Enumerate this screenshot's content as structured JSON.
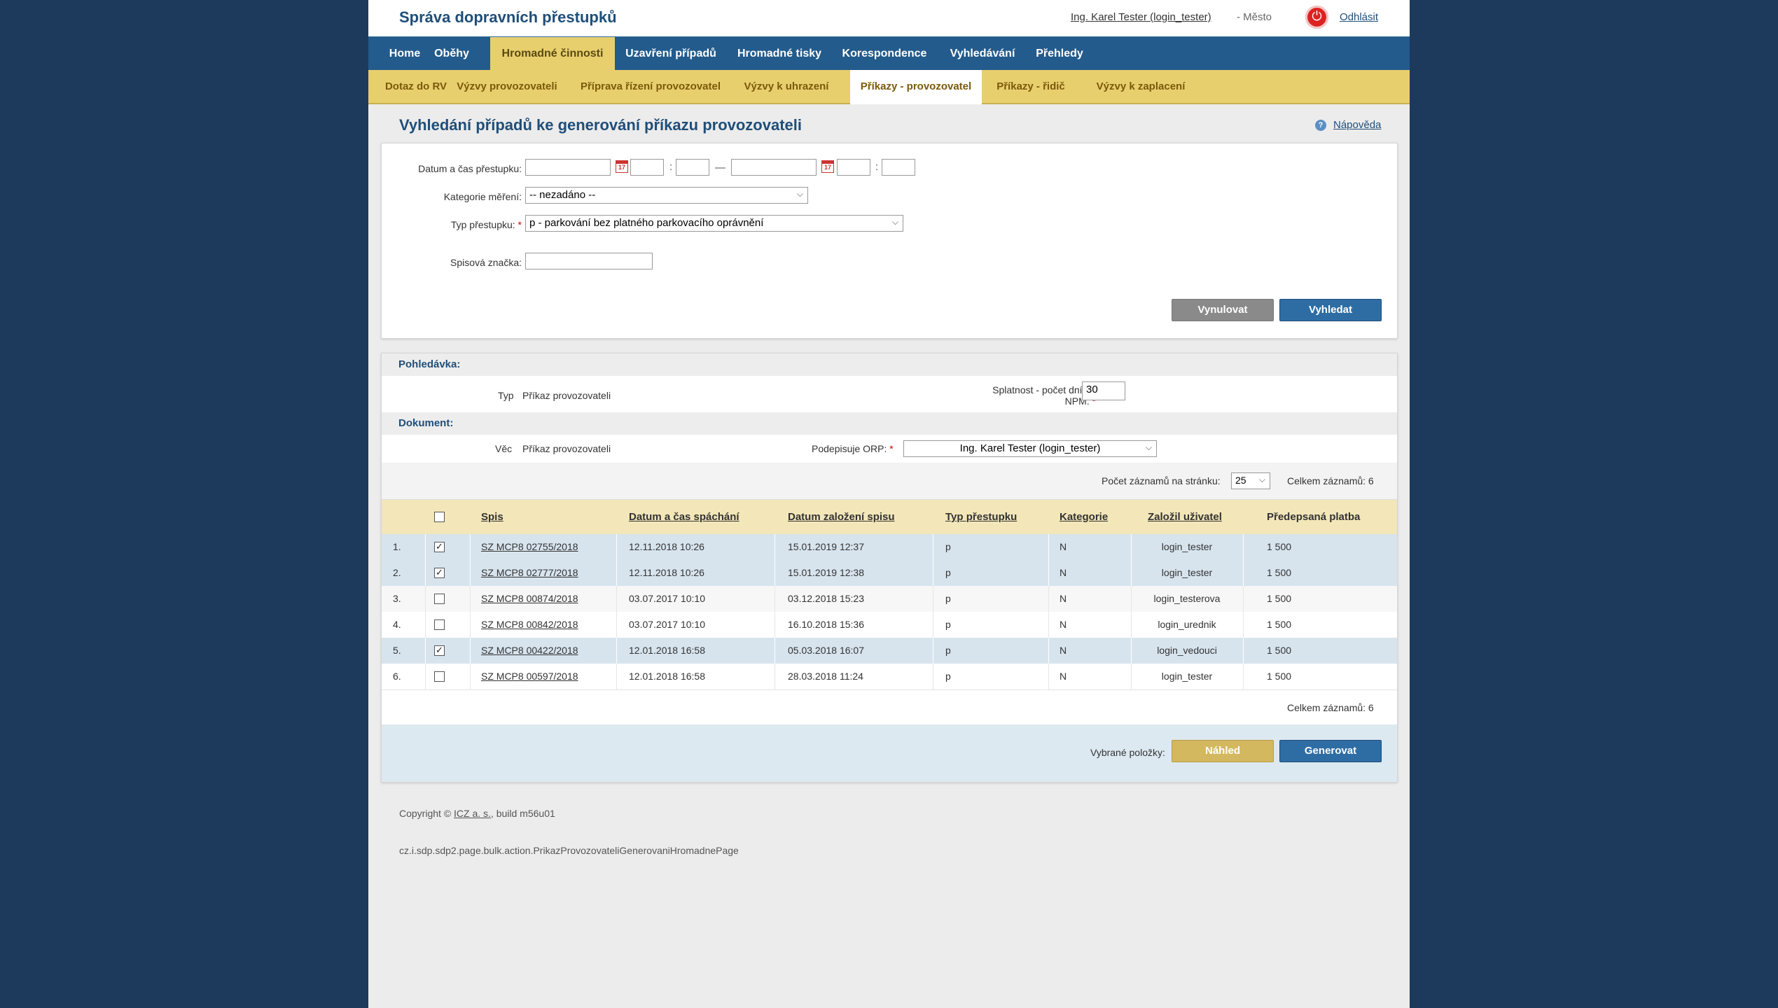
{
  "header": {
    "app_title": "Správa dopravních přestupků",
    "user": "Ing. Karel Tester (login_tester)",
    "city": "- Město",
    "logout": "Odhlásit"
  },
  "mainnav": [
    {
      "label": "Home",
      "active": false
    },
    {
      "label": "Oběhy",
      "active": false
    },
    {
      "label": "Hromadné činnosti",
      "active": true
    },
    {
      "label": "Uzavření případů",
      "active": false
    },
    {
      "label": "Hromadné tisky",
      "active": false
    },
    {
      "label": "Korespondence",
      "active": false
    },
    {
      "label": "Vyhledávání",
      "active": false
    },
    {
      "label": "Přehledy",
      "active": false
    }
  ],
  "subnav": [
    {
      "label": "Dotaz do RV",
      "active": false
    },
    {
      "label": "Výzvy provozovateli",
      "active": false
    },
    {
      "label": "Příprava řízení provozovatel",
      "active": false
    },
    {
      "label": "Výzvy k uhrazení",
      "active": false
    },
    {
      "label": "Příkazy - provozovatel",
      "active": true
    },
    {
      "label": "Příkazy - řidič",
      "active": false
    },
    {
      "label": "Výzvy k zaplacení",
      "active": false
    }
  ],
  "page": {
    "title": "Vyhledání případů ke generování příkazu provozovateli",
    "help": "Nápověda"
  },
  "search": {
    "datetime_label": "Datum a čas přestupku:",
    "date_sep": "—",
    "time_sep": ":",
    "calendar_day": "17",
    "category_label": "Kategorie měření:",
    "category_value": "-- nezadáno --",
    "type_label": "Typ přestupku:",
    "type_value": "p - parkování bez platného parkovacího oprávnění",
    "file_label": "Spisová značka:",
    "required": "*",
    "reset": "Vynulovat",
    "search": "Vyhledat"
  },
  "claim": {
    "header": "Pohledávka:",
    "type_label": "Typ",
    "type_value": "Příkaz provozovateli",
    "due_label_1": "Splatnost - počet dní od",
    "due_label_2": "NPM:",
    "due_value": "30"
  },
  "document": {
    "header": "Dokument:",
    "subject_label": "Věc",
    "subject_value": "Příkaz provozovateli",
    "signer_label": "Podepisuje ORP:",
    "signer_value": "Ing. Karel Tester (login_tester)"
  },
  "paging": {
    "per_page_label": "Počet záznamů na stránku:",
    "per_page_value": "25",
    "total": "Celkem záznamů: 6"
  },
  "table": {
    "columns": [
      "Spis",
      "Datum a čas spáchání",
      "Datum založení spisu",
      "Typ přestupku",
      "Kategorie",
      "Založil uživatel",
      "Předepsaná platba"
    ],
    "rows": [
      {
        "no": "1.",
        "checked": true,
        "spis": "SZ MCP8 02755/2018",
        "spachani": "12.11.2018 10:26",
        "zalozeni": "15.01.2019 12:37",
        "typ": "p",
        "kategorie": "N",
        "uzivatel": "login_tester",
        "platba": "1 500"
      },
      {
        "no": "2.",
        "checked": true,
        "spis": "SZ MCP8 02777/2018",
        "spachani": "12.11.2018 10:26",
        "zalozeni": "15.01.2019 12:38",
        "typ": "p",
        "kategorie": "N",
        "uzivatel": "login_tester",
        "platba": "1 500"
      },
      {
        "no": "3.",
        "checked": false,
        "spis": "SZ MCP8 00874/2018",
        "spachani": "03.07.2017 10:10",
        "zalozeni": "03.12.2018 15:23",
        "typ": "p",
        "kategorie": "N",
        "uzivatel": "login_testerova",
        "platba": "1 500"
      },
      {
        "no": "4.",
        "checked": false,
        "spis": "SZ MCP8 00842/2018",
        "spachani": "03.07.2017 10:10",
        "zalozeni": "16.10.2018 15:36",
        "typ": "p",
        "kategorie": "N",
        "uzivatel": "login_urednik",
        "platba": "1 500"
      },
      {
        "no": "5.",
        "checked": true,
        "spis": "SZ MCP8 00422/2018",
        "spachani": "12.01.2018 16:58",
        "zalozeni": "05.03.2018 16:07",
        "typ": "p",
        "kategorie": "N",
        "uzivatel": "login_vedouci",
        "platba": "1 500"
      },
      {
        "no": "6.",
        "checked": false,
        "spis": "SZ MCP8 00597/2018",
        "spachani": "12.01.2018 16:58",
        "zalozeni": "28.03.2018 11:24",
        "typ": "p",
        "kategorie": "N",
        "uzivatel": "login_tester",
        "platba": "1 500"
      }
    ]
  },
  "actions": {
    "selected_label": "Vybrané položky:",
    "preview": "Náhled",
    "generate": "Generovat"
  },
  "footer": {
    "copyright_prefix": "Copyright ©",
    "company": "ICZ a. s.",
    "build": ", build m56u01",
    "page_class": "cz.i.sdp.sdp2.page.bulk.action.PrikazProvozovateliGenerovaniHromadnePage"
  },
  "colors": {
    "nav": "#235b8c",
    "subnav": "#e8cf6e",
    "selected_row": "#d7e4ee",
    "primary_button": "#2e6da4"
  }
}
